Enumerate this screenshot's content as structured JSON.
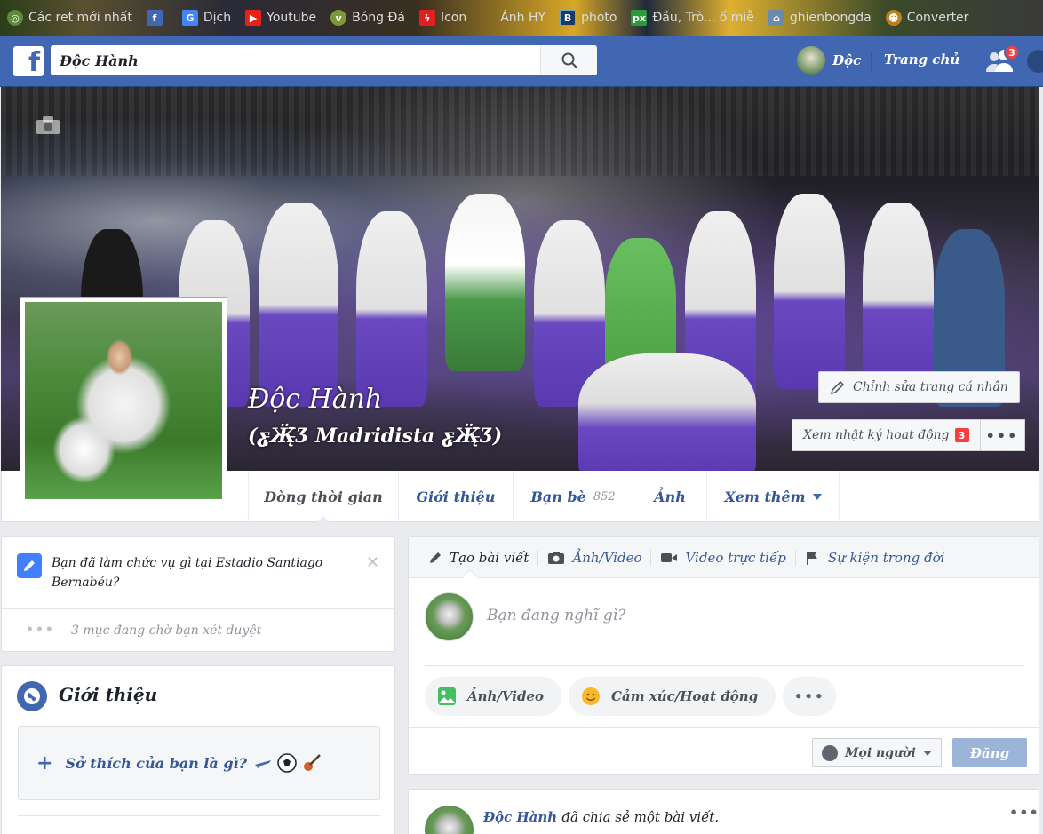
{
  "bookmarks": [
    {
      "label": "Các ret mới nhất",
      "icon": "globe-icon",
      "color": "#5a8a3a"
    },
    {
      "label": "",
      "icon": "facebook-icon",
      "color": "#4267b2"
    },
    {
      "label": "Dịch",
      "icon": "translate-icon",
      "color": "#4285f4"
    },
    {
      "label": "Youtube",
      "icon": "youtube-icon",
      "color": "#e62117"
    },
    {
      "label": "Bóng Đá",
      "icon": "soccer-icon",
      "color": "#7a9a3a"
    },
    {
      "label": "Icon",
      "icon": "flash-icon",
      "color": "#e02020"
    },
    {
      "label": "Ánh HY",
      "icon": "blank-icon",
      "color": "#555555"
    },
    {
      "label": "photo",
      "icon": "b-icon",
      "color": "#1a3a6a"
    },
    {
      "label": "Đầu, Trò... ổ miễ",
      "icon": "px-icon",
      "color": "#2a9a3a"
    },
    {
      "label": "ghienbongda",
      "icon": "house-icon",
      "color": "#6a8ab0"
    },
    {
      "label": "Converter",
      "icon": "monkey-icon",
      "color": "#c08020"
    }
  ],
  "topbar": {
    "logo": "f",
    "search_value": "Độc Hành",
    "profile_name": "Độc",
    "home_label": "Trang chủ",
    "friend_requests": "3"
  },
  "cover": {
    "name": "Độc Hành",
    "nickname": "(ƹ̵̡Ӝ̵̨̄Ʒ Madridista ƹ̵̡Ӝ̵̨̄Ʒ)",
    "edit_label": "Chỉnh sửa trang cá nhân",
    "activity_label": "Xem nhật ký hoạt động",
    "activity_count": "3",
    "more_label": "•••"
  },
  "tabs": [
    {
      "label": "Dòng thời gian",
      "active": true
    },
    {
      "label": "Giới thiệu"
    },
    {
      "label": "Bạn bè",
      "count": "852"
    },
    {
      "label": "Ảnh"
    },
    {
      "label": "Xem thêm"
    }
  ],
  "question": {
    "text": "Bạn đã làm chức vụ gì tại Estadio Santiago Bernabéu?",
    "close": "✕",
    "pending": "3 mục đang chờ bạn xét duyệt",
    "dots": "•••"
  },
  "intro": {
    "title": "Giới thiệu",
    "plus": "+",
    "hobby_prompt": "Sở thích của bạn là gì?"
  },
  "composer": {
    "tabs": [
      "Tạo bài viết",
      "Ảnh/Video",
      "Video trực tiếp",
      "Sự kiện trong đời"
    ],
    "placeholder": "Bạn đang nghĩ gì?",
    "photo_label": "Ảnh/Video",
    "feeling_label": "Cảm xúc/Hoạt động",
    "more_label": "•••",
    "audience_label": "Mọi người",
    "post_label": "Đăng"
  },
  "feed": {
    "author": "Độc Hành",
    "action": "đã chia sẻ một bài viết.",
    "more": "•••"
  }
}
